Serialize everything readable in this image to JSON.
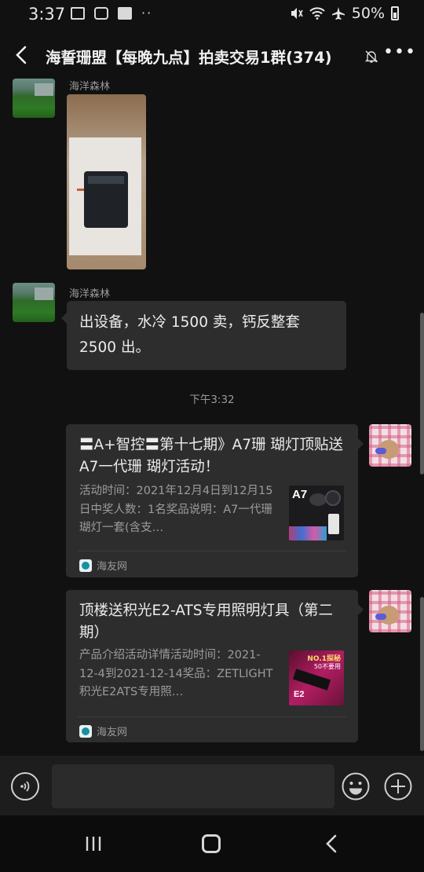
{
  "status": {
    "time": "3:37",
    "battery": "50%",
    "dots": "··"
  },
  "header": {
    "title": "海誓珊盟【每晚九点】拍卖交易1群(374)",
    "more": "•••"
  },
  "messages": {
    "photo_sender": "海洋森林",
    "text_sender": "海洋森林",
    "text": "出设备，水冷 1500 卖，钙反整套 2500 出。",
    "timestamp": "下午3:32"
  },
  "cards": [
    {
      "title": "〓A+智控〓第十七期》A7珊 瑚灯顶贴送A7一代珊 瑚灯活动！",
      "desc": "活动时间：2021年12月4日到12月15日中奖人数：1名奖品说明：A7一代珊瑚灯一套(含支…",
      "source": "海友网",
      "thumb_label": "A7"
    },
    {
      "title": "顶楼送积光E2-ATS专用照明灯具（第二期）",
      "desc": "产品介绍活动详情活动时间：2021-12-4到2021-12-14奖品：ZETLIGHT积光E2ATS专用照…",
      "source": "海友网",
      "thumb_label": "E2",
      "thumb_badge": "NO.1探秘",
      "thumb_sub": "50不要用"
    }
  ],
  "input": {
    "placeholder": ""
  },
  "colors": {
    "background": "#111111",
    "bubble": "#2d2d2d",
    "input_bar": "#1d1d1d"
  }
}
